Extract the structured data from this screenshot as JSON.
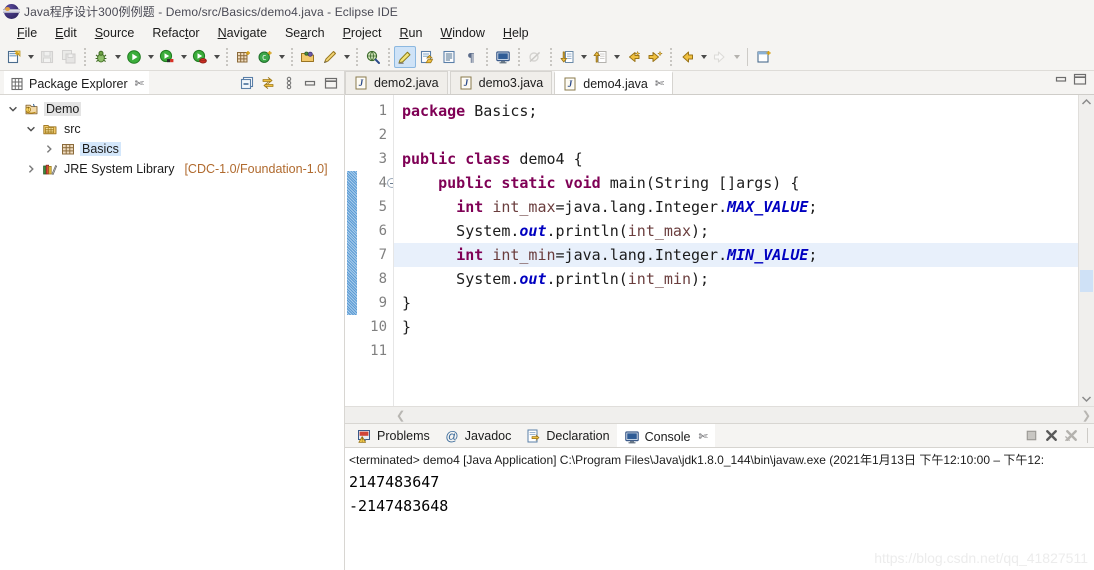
{
  "window": {
    "title": "Java程序设计300例例题 - Demo/src/Basics/demo4.java - Eclipse IDE",
    "app_icon": "eclipse-icon"
  },
  "menubar": {
    "items": [
      {
        "label": "File",
        "mnemonic": "F"
      },
      {
        "label": "Edit",
        "mnemonic": "E"
      },
      {
        "label": "Source",
        "mnemonic": "S"
      },
      {
        "label": "Refactor",
        "mnemonic": "t"
      },
      {
        "label": "Navigate",
        "mnemonic": "N"
      },
      {
        "label": "Search",
        "mnemonic": "a"
      },
      {
        "label": "Project",
        "mnemonic": "P"
      },
      {
        "label": "Run",
        "mnemonic": "R"
      },
      {
        "label": "Window",
        "mnemonic": "W"
      },
      {
        "label": "Help",
        "mnemonic": "H"
      }
    ]
  },
  "toolbar": {
    "buttons": [
      {
        "name": "new-wizard-button",
        "icon": "new-file-icon",
        "enabled": true,
        "dropdown": true
      },
      {
        "name": "save-button",
        "icon": "save-icon",
        "enabled": false,
        "dropdown": false
      },
      {
        "name": "save-all-button",
        "icon": "save-all-icon",
        "enabled": false,
        "dropdown": false
      },
      {
        "name": "debug-button",
        "icon": "debug-bug-icon",
        "enabled": true,
        "dropdown": true
      },
      {
        "name": "run-button",
        "icon": "run-play-icon",
        "enabled": true,
        "dropdown": true
      },
      {
        "name": "coverage-button",
        "icon": "run-coverage-icon",
        "enabled": true,
        "dropdown": true
      },
      {
        "name": "external-tools-button",
        "icon": "external-tools-icon",
        "enabled": true,
        "dropdown": true
      },
      {
        "name": "new-package-button",
        "icon": "new-package-icon",
        "enabled": true,
        "dropdown": false
      },
      {
        "name": "new-class-button",
        "icon": "new-class-icon",
        "enabled": true,
        "dropdown": true
      },
      {
        "name": "open-type-button",
        "icon": "open-folder-icon",
        "enabled": true,
        "dropdown": false
      },
      {
        "name": "open-task-button",
        "icon": "pencil-icon",
        "enabled": true,
        "dropdown": true
      },
      {
        "name": "search-button",
        "icon": "search-globe-icon",
        "enabled": true,
        "dropdown": false
      },
      {
        "name": "toggle-markup-button",
        "icon": "highlight-pen-icon",
        "enabled": true,
        "dropdown": false,
        "selected": true
      },
      {
        "name": "open-editor-button",
        "icon": "open-editor-icon",
        "enabled": true,
        "dropdown": false
      },
      {
        "name": "show-whitespace-button",
        "icon": "show-source-icon",
        "enabled": true,
        "dropdown": false
      },
      {
        "name": "pilcrow-button",
        "icon": "pilcrow-icon",
        "enabled": true,
        "dropdown": false
      },
      {
        "name": "console-button",
        "icon": "console-monitor-icon",
        "enabled": true,
        "dropdown": false
      },
      {
        "name": "skip-breakpoints-button",
        "icon": "skip-breakpoints-icon",
        "enabled": false,
        "dropdown": false
      },
      {
        "name": "next-annotation-button",
        "icon": "next-annotation-icon",
        "enabled": true,
        "dropdown": true
      },
      {
        "name": "previous-annotation-button",
        "icon": "prev-annotation-icon",
        "enabled": true,
        "dropdown": true
      },
      {
        "name": "last-edit-location-button",
        "icon": "last-edit-icon",
        "enabled": true,
        "dropdown": false
      },
      {
        "name": "forward-edit-button",
        "icon": "forward-edit-icon",
        "enabled": true,
        "dropdown": false
      },
      {
        "name": "back-button",
        "icon": "back-arrow-icon",
        "enabled": true,
        "dropdown": true
      },
      {
        "name": "forward-button",
        "icon": "forward-arrow-icon",
        "enabled": false,
        "dropdown": true
      },
      {
        "name": "new-window-button",
        "icon": "new-window-icon",
        "enabled": true,
        "dropdown": false
      }
    ]
  },
  "package_explorer": {
    "tab_label": "Package Explorer",
    "tab_icon": "package-explorer-icon",
    "close_glyph": "✄",
    "tools": [
      {
        "name": "collapse-all-button",
        "icon": "collapse-all-icon"
      },
      {
        "name": "link-with-editor-button",
        "icon": "link-editor-icon"
      },
      {
        "name": "view-menu-button",
        "icon": "view-menu-icon"
      },
      {
        "name": "minimize-view-button",
        "icon": "minimize-icon"
      },
      {
        "name": "maximize-view-button",
        "icon": "maximize-icon"
      }
    ],
    "tree": [
      {
        "label": "Demo",
        "icon": "java-project-icon",
        "indent": 0,
        "twisty": "expanded",
        "selected": "gray",
        "suffix": ""
      },
      {
        "label": "src",
        "icon": "source-folder-icon",
        "indent": 1,
        "twisty": "expanded",
        "selected": "none",
        "suffix": ""
      },
      {
        "label": "Basics",
        "icon": "package-icon",
        "indent": 2,
        "twisty": "collapsed",
        "selected": "blue",
        "suffix": ""
      },
      {
        "label": "JRE System Library",
        "icon": "library-icon",
        "indent": 1,
        "twisty": "collapsed",
        "selected": "none",
        "suffix": "[CDC-1.0/Foundation-1.0]"
      }
    ]
  },
  "editor": {
    "tabs": [
      {
        "label": "demo2.java",
        "icon": "java-file-icon",
        "active": false,
        "closable": false
      },
      {
        "label": "demo3.java",
        "icon": "java-file-icon",
        "active": false,
        "closable": false
      },
      {
        "label": "demo4.java",
        "icon": "java-file-icon",
        "active": true,
        "closable": true
      }
    ],
    "close_glyph": "✄",
    "tools": [
      {
        "name": "minimize-editor-button",
        "icon": "minimize-icon"
      },
      {
        "name": "maximize-editor-button",
        "icon": "maximize-icon"
      }
    ],
    "current_line": 7,
    "change_bar_from_line": 4,
    "change_bar_to_line": 9,
    "folding_lines": [
      4
    ],
    "lines": [
      {
        "n": 1,
        "tokens": [
          {
            "t": "package",
            "c": "kw"
          },
          {
            "t": " Basics;",
            "c": "plain"
          }
        ]
      },
      {
        "n": 2,
        "tokens": []
      },
      {
        "n": 3,
        "tokens": [
          {
            "t": "public",
            "c": "kw"
          },
          {
            "t": " ",
            "c": "plain"
          },
          {
            "t": "class",
            "c": "kw"
          },
          {
            "t": " demo4 {",
            "c": "plain"
          }
        ]
      },
      {
        "n": 4,
        "tokens": [
          {
            "t": "    ",
            "c": "plain"
          },
          {
            "t": "public",
            "c": "kw"
          },
          {
            "t": " ",
            "c": "plain"
          },
          {
            "t": "static",
            "c": "kw"
          },
          {
            "t": " ",
            "c": "plain"
          },
          {
            "t": "void",
            "c": "kw"
          },
          {
            "t": " main(String []args) {",
            "c": "plain"
          }
        ]
      },
      {
        "n": 5,
        "tokens": [
          {
            "t": "      ",
            "c": "plain"
          },
          {
            "t": "int",
            "c": "kw"
          },
          {
            "t": " ",
            "c": "plain"
          },
          {
            "t": "int_max",
            "c": "var"
          },
          {
            "t": "=java.lang.Integer.",
            "c": "plain"
          },
          {
            "t": "MAX_VALUE",
            "c": "sf"
          },
          {
            "t": ";",
            "c": "plain"
          }
        ]
      },
      {
        "n": 6,
        "tokens": [
          {
            "t": "      System.",
            "c": "plain"
          },
          {
            "t": "out",
            "c": "fld"
          },
          {
            "t": ".println(",
            "c": "plain"
          },
          {
            "t": "int_max",
            "c": "var"
          },
          {
            "t": ");",
            "c": "plain"
          }
        ]
      },
      {
        "n": 7,
        "tokens": [
          {
            "t": "      ",
            "c": "plain"
          },
          {
            "t": "int",
            "c": "kw"
          },
          {
            "t": " ",
            "c": "plain"
          },
          {
            "t": "int_min",
            "c": "var"
          },
          {
            "t": "=java.lang.Integer.",
            "c": "plain"
          },
          {
            "t": "MIN_VALUE",
            "c": "sf"
          },
          {
            "t": ";",
            "c": "plain"
          }
        ]
      },
      {
        "n": 8,
        "tokens": [
          {
            "t": "      System.",
            "c": "plain"
          },
          {
            "t": "out",
            "c": "fld"
          },
          {
            "t": ".println(",
            "c": "plain"
          },
          {
            "t": "int_min",
            "c": "var"
          },
          {
            "t": ");",
            "c": "plain"
          }
        ]
      },
      {
        "n": 9,
        "tokens": [
          {
            "t": "}",
            "c": "plain"
          }
        ]
      },
      {
        "n": 10,
        "tokens": [
          {
            "t": "}",
            "c": "plain"
          }
        ]
      },
      {
        "n": 11,
        "tokens": []
      }
    ]
  },
  "console_panel": {
    "tabs": [
      {
        "label": "Problems",
        "icon": "problems-icon",
        "active": false,
        "closable": false
      },
      {
        "label": "Javadoc",
        "icon": "javadoc-at-icon",
        "active": false,
        "closable": false
      },
      {
        "label": "Declaration",
        "icon": "declaration-icon",
        "active": false,
        "closable": false
      },
      {
        "label": "Console",
        "icon": "console-icon",
        "active": true,
        "closable": true
      }
    ],
    "close_glyph": "✄",
    "tools": [
      {
        "name": "terminate-button",
        "icon": "stop-square-icon",
        "enabled": false
      },
      {
        "name": "remove-launch-button",
        "icon": "remove-x-icon",
        "enabled": true
      },
      {
        "name": "remove-all-launches-button",
        "icon": "remove-all-x-icon",
        "enabled": false
      }
    ],
    "status_line": "<terminated> demo4 [Java Application] C:\\Program Files\\Java\\jdk1.8.0_144\\bin\\javaw.exe  (2021年1月13日 下午12:10:00 – 下午12:",
    "output": [
      "2147483647",
      "-2147483648"
    ]
  },
  "watermark": "https://blog.csdn.net/qq_41827511",
  "colors": {
    "keyword": "#7f0055",
    "static_field": "#0000c0",
    "local_var": "#6a3d3d",
    "current_line_bg": "#e8f0fb",
    "selection_blue": "#d4e7fb",
    "chrome_bg": "#f5f4f2"
  }
}
